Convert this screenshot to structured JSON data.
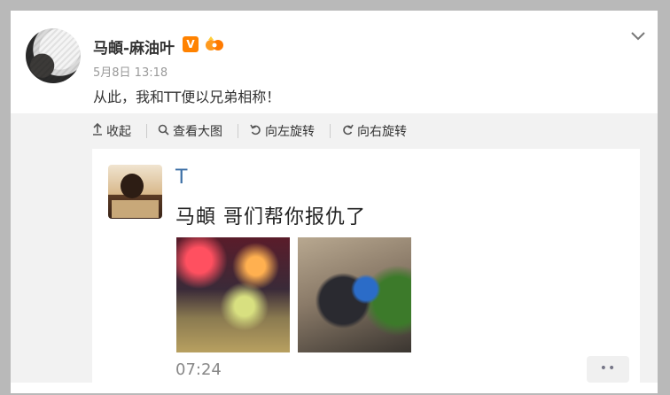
{
  "post": {
    "username": "马頔-麻油叶",
    "verified_badge": "V",
    "timestamp": "5月8日 13:18",
    "text": "从此，我和TT便以兄弟相称！"
  },
  "toolbar": {
    "collapse_label": "收起",
    "view_large_label": "查看大图",
    "rotate_left_label": "向左旋转",
    "rotate_right_label": "向右旋转"
  },
  "embedded": {
    "name": "T",
    "text": "马頔 哥们帮你报仇了",
    "video_time": "07:24",
    "more_label": "••"
  },
  "colors": {
    "background": "#b9b9b9",
    "toolbar_bg": "#f2f2f2",
    "link_blue": "#3b6ea5",
    "badge_orange": "#ff8200"
  },
  "icons": [
    "chevron-down-icon",
    "collapse-icon",
    "search-icon",
    "rotate-left-icon",
    "rotate-right-icon",
    "fan-badge-icon"
  ]
}
